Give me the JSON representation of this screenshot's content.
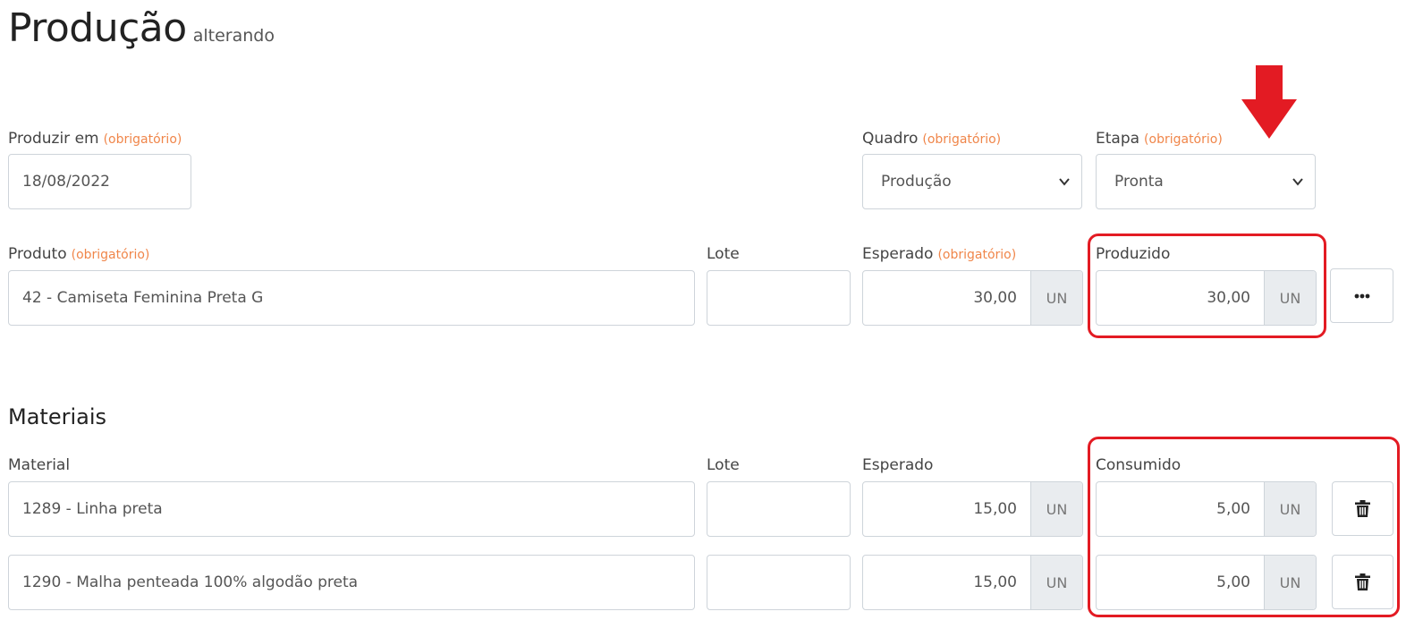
{
  "header": {
    "title": "Produção",
    "subtitle": "alterando"
  },
  "required_text": "(obrigatório)",
  "form": {
    "produzir_em": {
      "label": "Produzir em",
      "value": "18/08/2022"
    },
    "quadro": {
      "label": "Quadro",
      "value": "Produção"
    },
    "etapa": {
      "label": "Etapa",
      "value": "Pronta"
    },
    "produto": {
      "label": "Produto",
      "value": "42 - Camiseta Feminina Preta G"
    },
    "lote": {
      "label": "Lote",
      "value": ""
    },
    "esperado": {
      "label": "Esperado",
      "value": "30,00",
      "unit": "UN"
    },
    "produzido": {
      "label": "Produzido",
      "value": "30,00",
      "unit": "UN"
    }
  },
  "materiais": {
    "title": "Materiais",
    "columns": {
      "material": "Material",
      "lote": "Lote",
      "esperado": "Esperado",
      "consumido": "Consumido"
    },
    "rows": [
      {
        "material": "1289 - Linha preta",
        "lote": "",
        "esperado": "15,00",
        "esperado_unit": "UN",
        "consumido": "5,00",
        "consumido_unit": "UN"
      },
      {
        "material": "1290 - Malha penteada 100% algodão preta",
        "lote": "",
        "esperado": "15,00",
        "esperado_unit": "UN",
        "consumido": "5,00",
        "consumido_unit": "UN"
      }
    ]
  },
  "icons": {
    "more": "ellipsis-icon",
    "delete": "trash-icon",
    "dropdown": "chevron-down-icon",
    "annotation": "down-arrow-icon"
  },
  "colors": {
    "required": "#f0864a",
    "highlight": "#e31b23",
    "addon_bg": "#e9ecef",
    "border": "#ced4da"
  }
}
